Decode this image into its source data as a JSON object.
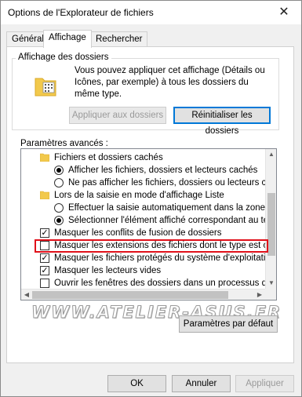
{
  "window": {
    "title": "Options de l'Explorateur de fichiers",
    "close_glyph": "✕"
  },
  "tabs": [
    {
      "label": "Général"
    },
    {
      "label": "Affichage"
    },
    {
      "label": "Rechercher"
    }
  ],
  "folder_views": {
    "legend": "Affichage des dossiers",
    "description": "Vous pouvez appliquer cet affichage (Détails ou Icônes, par exemple) à tous les dossiers du même type.",
    "apply_button": "Appliquer aux dossiers",
    "reset_button": "Réinitialiser les dossiers"
  },
  "advanced": {
    "label": "Paramètres avancés :",
    "items": [
      {
        "kind": "folder",
        "text": "Fichiers et dossiers cachés"
      },
      {
        "kind": "radio",
        "checked": true,
        "text": "Afficher les fichiers, dossiers et lecteurs cachés"
      },
      {
        "kind": "radio",
        "checked": false,
        "text": "Ne pas afficher les fichiers, dossiers ou lecteurs cachés"
      },
      {
        "kind": "folder",
        "text": "Lors de la saisie en mode d'affichage Liste"
      },
      {
        "kind": "radio",
        "checked": false,
        "text": "Effectuer la saisie automatiquement dans la zone Recherche"
      },
      {
        "kind": "radio",
        "checked": true,
        "text": "Sélectionner l'élément affiché correspondant au texte saisi"
      },
      {
        "kind": "checkbox",
        "checked": true,
        "text": "Masquer les conflits de fusion de dossiers"
      },
      {
        "kind": "checkbox",
        "checked": false,
        "text": "Masquer les extensions des fichiers dont le type est connu"
      },
      {
        "kind": "checkbox",
        "checked": true,
        "text": "Masquer les fichiers protégés du système d'exploitation (recommandé)"
      },
      {
        "kind": "checkbox",
        "checked": true,
        "text": "Masquer les lecteurs vides"
      },
      {
        "kind": "checkbox",
        "checked": false,
        "text": "Ouvrir les fenêtres des dossiers dans un processus différent"
      }
    ],
    "restore_button": "Paramètres par défaut"
  },
  "watermark": "WWW.ATELIER-ASUS.FR",
  "footer": {
    "ok": "OK",
    "cancel": "Annuler",
    "apply": "Appliquer"
  },
  "colors": {
    "accent": "#0078d7",
    "highlight": "#e0101a",
    "folder": "#f2c94c"
  }
}
